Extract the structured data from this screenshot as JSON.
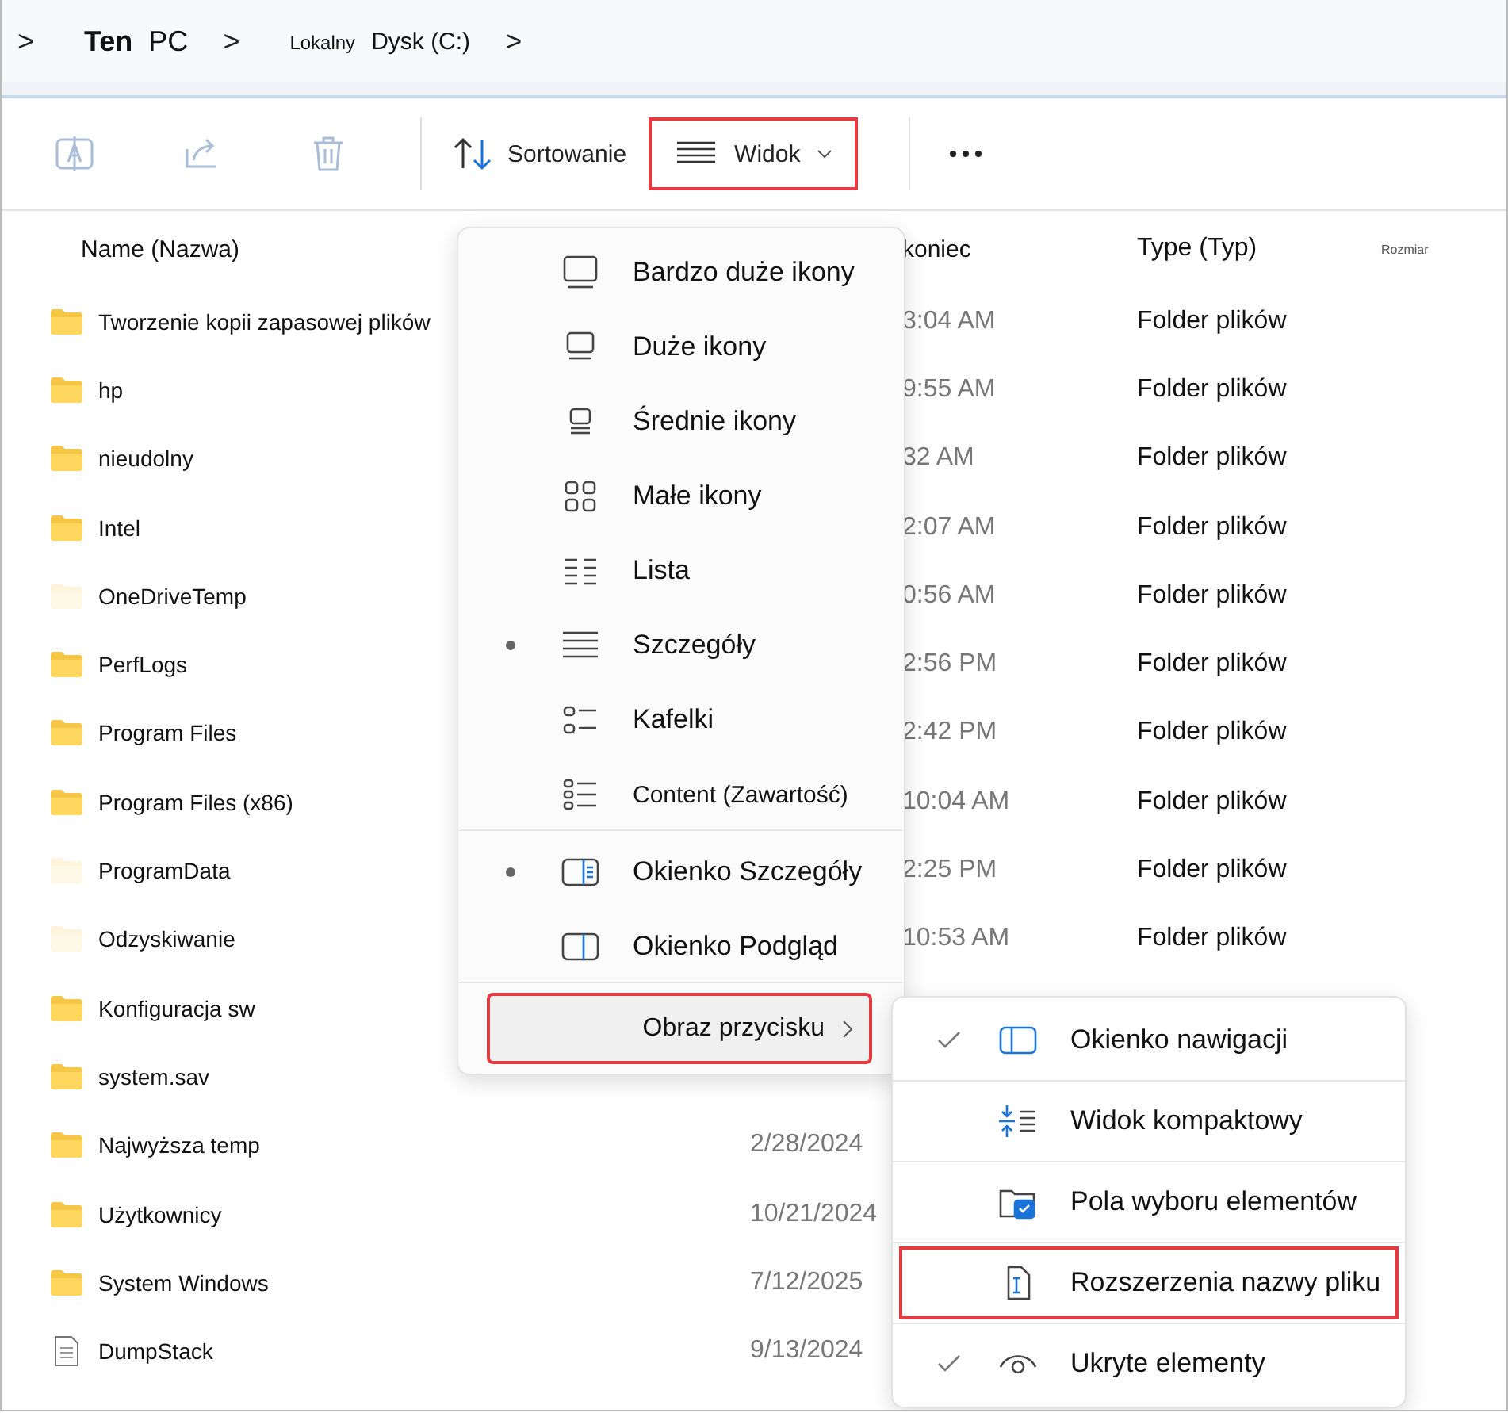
{
  "breadcrumb": [
    {
      "kind": "chevron",
      "text": ">"
    },
    {
      "kind": "crumb",
      "parts": [
        "Ten",
        "PC"
      ]
    },
    {
      "kind": "chevron",
      "text": ">"
    },
    {
      "kind": "crumb",
      "parts": [
        "Lokalny",
        "Dysk (C:)"
      ]
    },
    {
      "kind": "chevron",
      "text": ">"
    }
  ],
  "toolbar": [
    {
      "kind": "rename",
      "disabled": true
    },
    {
      "kind": "share",
      "disabled": true
    },
    {
      "kind": "delete",
      "disabled": true
    },
    {
      "kind": "sort",
      "label": "Sortowanie",
      "disabled": false
    },
    {
      "kind": "view",
      "label": "Widok",
      "disabled": false,
      "highlighted": true
    },
    {
      "kind": "more",
      "disabled": false
    }
  ],
  "columns": [
    "Name (Nazwa)",
    "koniec",
    "Type (Typ)",
    "Rozmiar"
  ],
  "rows": [
    {
      "name": "Tworzenie kopii zapasowej plików",
      "kind": "folder",
      "hidden": false,
      "date": "3:04 AM",
      "type": "Folder plików"
    },
    {
      "name": "hp",
      "kind": "folder",
      "hidden": false,
      "date": "9:55 AM",
      "type": "Folder plików"
    },
    {
      "name": "nieudolny",
      "kind": "folder",
      "hidden": false,
      "date": "32 AM",
      "type": "Folder plików"
    },
    {
      "name": "Intel",
      "kind": "folder",
      "hidden": false,
      "date": "2:07 AM",
      "type": "Folder plików"
    },
    {
      "name": "OneDriveTemp",
      "kind": "folder",
      "hidden": true,
      "date": "0:56 AM",
      "type": "Folder plików"
    },
    {
      "name": "PerfLogs",
      "kind": "folder",
      "hidden": false,
      "date": "2:56 PM",
      "type": "Folder plików"
    },
    {
      "name": "Program Files",
      "kind": "folder",
      "hidden": false,
      "date": "2:42 PM",
      "type": "Folder plików"
    },
    {
      "name": "Program Files (x86)",
      "kind": "folder",
      "hidden": false,
      "date": "10:04 AM",
      "type": "Folder plików"
    },
    {
      "name": "ProgramData",
      "kind": "folder",
      "hidden": true,
      "date": "2:25 PM",
      "type": "Folder plików"
    },
    {
      "name": "Odzyskiwanie",
      "kind": "folder",
      "hidden": true,
      "date": "10:53 AM",
      "type": "Folder plików"
    },
    {
      "name": "Konfiguracja sw",
      "kind": "folder",
      "hidden": false
    },
    {
      "name": "system.sav",
      "kind": "folder",
      "hidden": false
    },
    {
      "name": "Najwyższa temp",
      "kind": "folder",
      "hidden": false,
      "date": "2/28/2024"
    },
    {
      "name": "Użytkownicy",
      "kind": "folder",
      "hidden": false,
      "date": "10/21/2024"
    },
    {
      "name": "System Windows",
      "kind": "folder",
      "hidden": false,
      "date": "7/12/2025"
    },
    {
      "name": "DumpStack",
      "kind": "file",
      "hidden": false,
      "date": "9/13/2024"
    }
  ],
  "view_menu": {
    "items": [
      {
        "kind": "xl",
        "label": "Bardzo duże ikony",
        "selected": false
      },
      {
        "kind": "large",
        "label": "Duże ikony",
        "selected": false
      },
      {
        "kind": "medium",
        "label": "Średnie ikony",
        "selected": false
      },
      {
        "kind": "small",
        "label": "Małe ikony",
        "selected": false
      },
      {
        "kind": "list",
        "label": "Lista",
        "selected": false
      },
      {
        "kind": "details",
        "label": "Szczegóły",
        "selected": true
      },
      {
        "kind": "tiles",
        "label": "Kafelki",
        "selected": false
      },
      {
        "kind": "content",
        "label": "Content (Zawartość)",
        "selected": false,
        "separator_after": true
      },
      {
        "kind": "details_pane",
        "label": "Okienko Szczegóły",
        "selected": true
      },
      {
        "kind": "preview_pane",
        "label": "Okienko Podgląd",
        "selected": false,
        "separator_after": true
      }
    ],
    "submenu_trigger": {
      "label": "Obraz przycisku",
      "highlighted": true
    }
  },
  "show_menu": [
    {
      "kind": "nav_pane",
      "label": "Okienko nawigacji",
      "checked": true,
      "highlighted": false
    },
    {
      "kind": "compact",
      "label": "Widok kompaktowy",
      "checked": false,
      "highlighted": false
    },
    {
      "kind": "checkboxes",
      "label": "Pola wyboru elementów",
      "checked": false,
      "highlighted": false
    },
    {
      "kind": "extensions",
      "label": "Rozszerzenia nazwy pliku",
      "checked": false,
      "highlighted": true
    },
    {
      "kind": "hidden",
      "label": "Ukryte elementy",
      "checked": true,
      "highlighted": false
    }
  ]
}
